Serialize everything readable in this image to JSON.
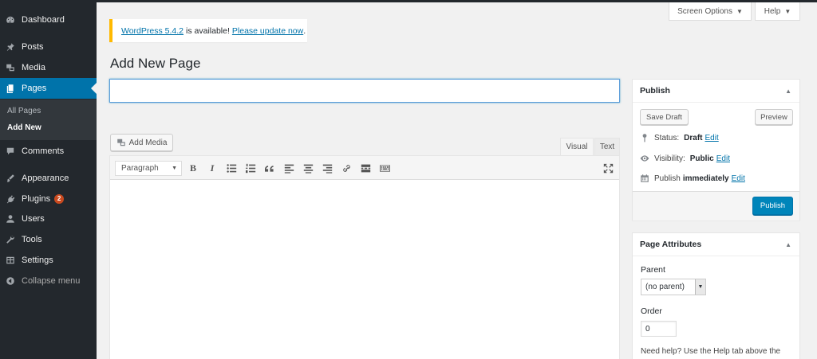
{
  "sidebar": {
    "items": [
      {
        "label": "Dashboard",
        "icon": "dashboard-icon"
      },
      {
        "label": "Posts",
        "icon": "pin-icon"
      },
      {
        "label": "Media",
        "icon": "media-icon"
      },
      {
        "label": "Pages",
        "icon": "pages-icon"
      },
      {
        "label": "Comments",
        "icon": "comment-icon"
      },
      {
        "label": "Appearance",
        "icon": "brush-icon"
      },
      {
        "label": "Plugins",
        "icon": "plugin-icon",
        "badge": "2"
      },
      {
        "label": "Users",
        "icon": "user-icon"
      },
      {
        "label": "Tools",
        "icon": "wrench-icon"
      },
      {
        "label": "Settings",
        "icon": "settings-icon"
      },
      {
        "label": "Collapse menu",
        "icon": "collapse-icon"
      }
    ],
    "submenu": [
      "All Pages",
      "Add New"
    ],
    "active_color": "#0073aa"
  },
  "top": {
    "screen_options": "Screen Options",
    "help": "Help"
  },
  "notice": {
    "link1": "WordPress 5.4.2",
    "text": "is available!",
    "link2": "Please update now",
    "end": "."
  },
  "page": {
    "title": "Add New Page",
    "title_value": ""
  },
  "editor": {
    "add_media": "Add Media",
    "tab_visual": "Visual",
    "tab_text": "Text",
    "format": "Paragraph"
  },
  "publish": {
    "heading": "Publish",
    "save_draft": "Save Draft",
    "preview": "Preview",
    "status_label": "Status:",
    "status_value": "Draft",
    "visibility_label": "Visibility:",
    "visibility_value": "Public",
    "publish_label": "Publish",
    "publish_value": "immediately",
    "edit": "Edit",
    "publish_button": "Publish"
  },
  "attributes": {
    "heading": "Page Attributes",
    "parent_label": "Parent",
    "parent_value": "(no parent)",
    "order_label": "Order",
    "order_value": "0",
    "help": "Need help? Use the Help tab above the"
  }
}
